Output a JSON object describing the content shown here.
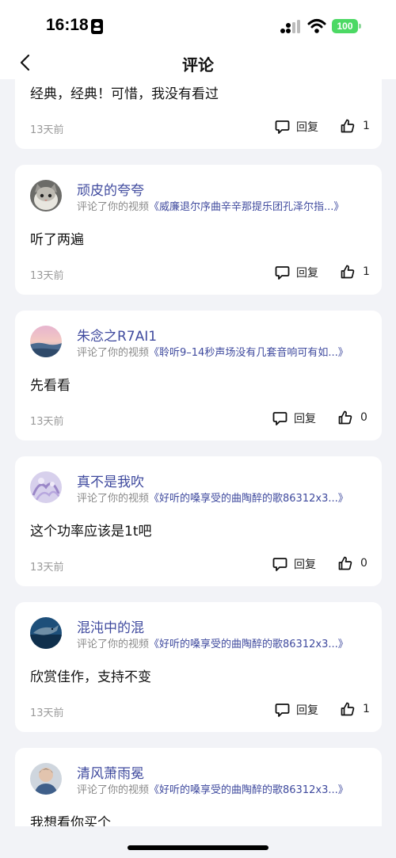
{
  "status_bar": {
    "time": "16:18",
    "battery": "100"
  },
  "nav": {
    "title": "评论"
  },
  "reply_label": "回复",
  "comments": [
    {
      "content": "经典，经典！可惜，我没有看过",
      "time": "13天前",
      "likes": "1"
    },
    {
      "username": "顽皮的夸夸",
      "prefix": "评论了你的视频",
      "video": "《威廉退尔序曲辛辛那提乐团孔泽尔指...》",
      "content": "听了两遍",
      "time": "13天前",
      "likes": "1"
    },
    {
      "username": "朱念之R7AI1",
      "prefix": "评论了你的视频",
      "video": "《聆听9–14秒声场没有几套音响可有如...》",
      "content": "先看看",
      "time": "13天前",
      "likes": "0"
    },
    {
      "username": "真不是我吹",
      "prefix": "评论了你的视频",
      "video": "《好听的嗓享受的曲陶醉的歌86312x3...》",
      "content": "这个功率应该是1t吧",
      "time": "13天前",
      "likes": "0"
    },
    {
      "username": "混沌中的混",
      "prefix": "评论了你的视频",
      "video": "《好听的嗓享受的曲陶醉的歌86312x3...》",
      "content": "欣赏佳作，支持不变",
      "time": "13天前",
      "likes": "1"
    },
    {
      "username": "清风萧雨冕",
      "prefix": "评论了你的视频",
      "video": "《好听的嗓享受的曲陶醉的歌86312x3...》",
      "content": "我想看你买个"
    }
  ]
}
